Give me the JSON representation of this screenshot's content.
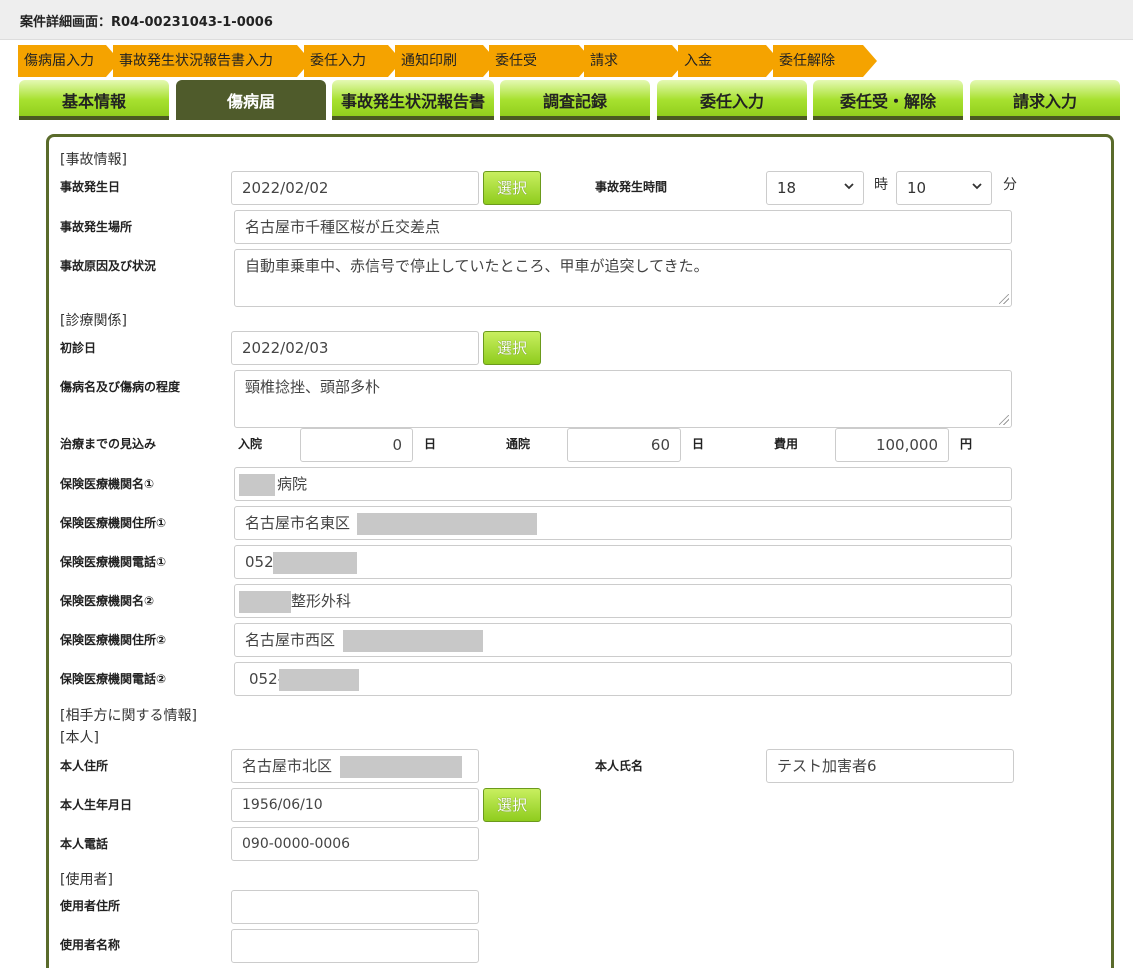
{
  "header": {
    "title": "案件詳細画面：R04-00231043-1-0006"
  },
  "steps": [
    "傷病届入力",
    "事故発生状況報告書入力",
    "委任入力",
    "通知印刷",
    "委任受",
    "請求",
    "入金",
    "委任解除"
  ],
  "tabs": [
    "基本情報",
    "傷病届",
    "事故発生状況報告書",
    "調査記録",
    "委任入力",
    "委任受・解除",
    "請求入力"
  ],
  "active_tab": "傷病届",
  "accident": {
    "section": "[事故情報]",
    "date_label": "事故発生日",
    "date_value": "2022/02/02",
    "select_label": "選択",
    "time_label": "事故発生時間",
    "hour": "18",
    "hour_unit": "時",
    "minute": "10",
    "minute_unit": "分",
    "place_label": "事故発生場所",
    "place_value": "名古屋市千種区桜が丘交差点",
    "cause_label": "事故原因及び状況",
    "cause_value": "自動車乗車中、赤信号で停止していたところ、甲車が追突してきた。"
  },
  "medical": {
    "section": "[診療関係]",
    "first_visit_label": "初診日",
    "first_visit_value": "2022/02/03",
    "select_label": "選択",
    "injury_label": "傷病名及び傷病の程度",
    "injury_value": "頸椎捻挫、頭部多朴",
    "outlook_label": "治療までの見込み",
    "inpatient_label": "入院",
    "inpatient_value": "0",
    "day_unit": "日",
    "outpatient_label": "通院",
    "outpatient_value": "60",
    "cost_label": "費用",
    "cost_value": "100,000",
    "cost_unit": "円",
    "inst1_name_label": "保険医療機関名①",
    "inst1_name_value": "病院",
    "inst1_addr_label": "保険医療機関住所①",
    "inst1_addr_value": "名古屋市名東区",
    "inst1_tel_label": "保険医療機関電話①",
    "inst1_tel_value": "052",
    "inst2_name_label": "保険医療機関名②",
    "inst2_name_value": "整形外科",
    "inst2_addr_label": "保険医療機関住所②",
    "inst2_addr_value": "名古屋市西区",
    "inst2_tel_label": "保険医療機関電話②",
    "inst2_tel_value": "052-"
  },
  "other_party": {
    "section": "[相手方に関する情報]",
    "self_section": "[本人]",
    "address_label": "本人住所",
    "address_value": "名古屋市北区",
    "name_label": "本人氏名",
    "name_value": "テスト加害者6",
    "birth_label": "本人生年月日",
    "birth_value": "1956/06/10",
    "select_label": "選択",
    "tel_label": "本人電話",
    "tel_value": "090-0000-0006",
    "user_section": "[使用者]",
    "user_address_label": "使用者住所",
    "user_address_value": "",
    "user_name_label": "使用者名称",
    "user_name_value": ""
  }
}
